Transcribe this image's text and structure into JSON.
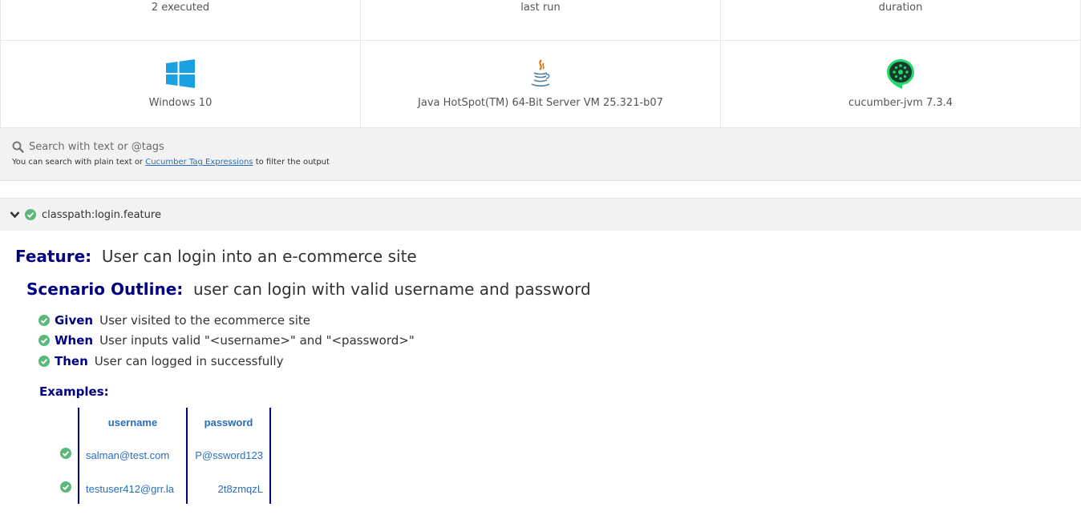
{
  "stats": {
    "executed": "2 executed",
    "last_run": "last run",
    "duration": "duration"
  },
  "environment": {
    "os": "Windows 10",
    "runtime": "Java HotSpot(TM) 64-Bit Server VM 25.321-b07",
    "framework": "cucumber-jvm 7.3.4"
  },
  "search": {
    "placeholder": "Search with text or @tags",
    "help_prefix": "You can search with plain text or ",
    "help_link": "Cucumber Tag Expressions",
    "help_suffix": " to filter the output"
  },
  "feature_file": {
    "path": "classpath:login.feature"
  },
  "feature": {
    "keyword": "Feature:",
    "name": "User can login into an e-commerce site"
  },
  "scenario": {
    "keyword": "Scenario Outline:",
    "name": "user can login with valid username and password"
  },
  "steps": [
    {
      "keyword": "Given",
      "text": "User visited to the ecommerce site"
    },
    {
      "keyword": "When",
      "text": "User inputs valid \"<username>\" and \"<password>\""
    },
    {
      "keyword": "Then",
      "text": "User can logged in successfully"
    }
  ],
  "examples": {
    "title": "Examples:",
    "headers": [
      "username",
      "password"
    ],
    "rows": [
      [
        "salman@test.com",
        "P@ssword123"
      ],
      [
        "testuser412@grr.la",
        "2t8zmqzL"
      ]
    ]
  },
  "colors": {
    "passed": "#5ab87a",
    "keyword": "#000080",
    "link": "#2a6ebb",
    "windows": "#1ba1e2",
    "cucumber": "#23d96c"
  },
  "icons": {
    "os": "windows-icon",
    "runtime": "java-icon",
    "framework": "cucumber-icon",
    "search": "search-icon",
    "collapse": "chevron-down-icon",
    "status": "check-circle-icon"
  }
}
